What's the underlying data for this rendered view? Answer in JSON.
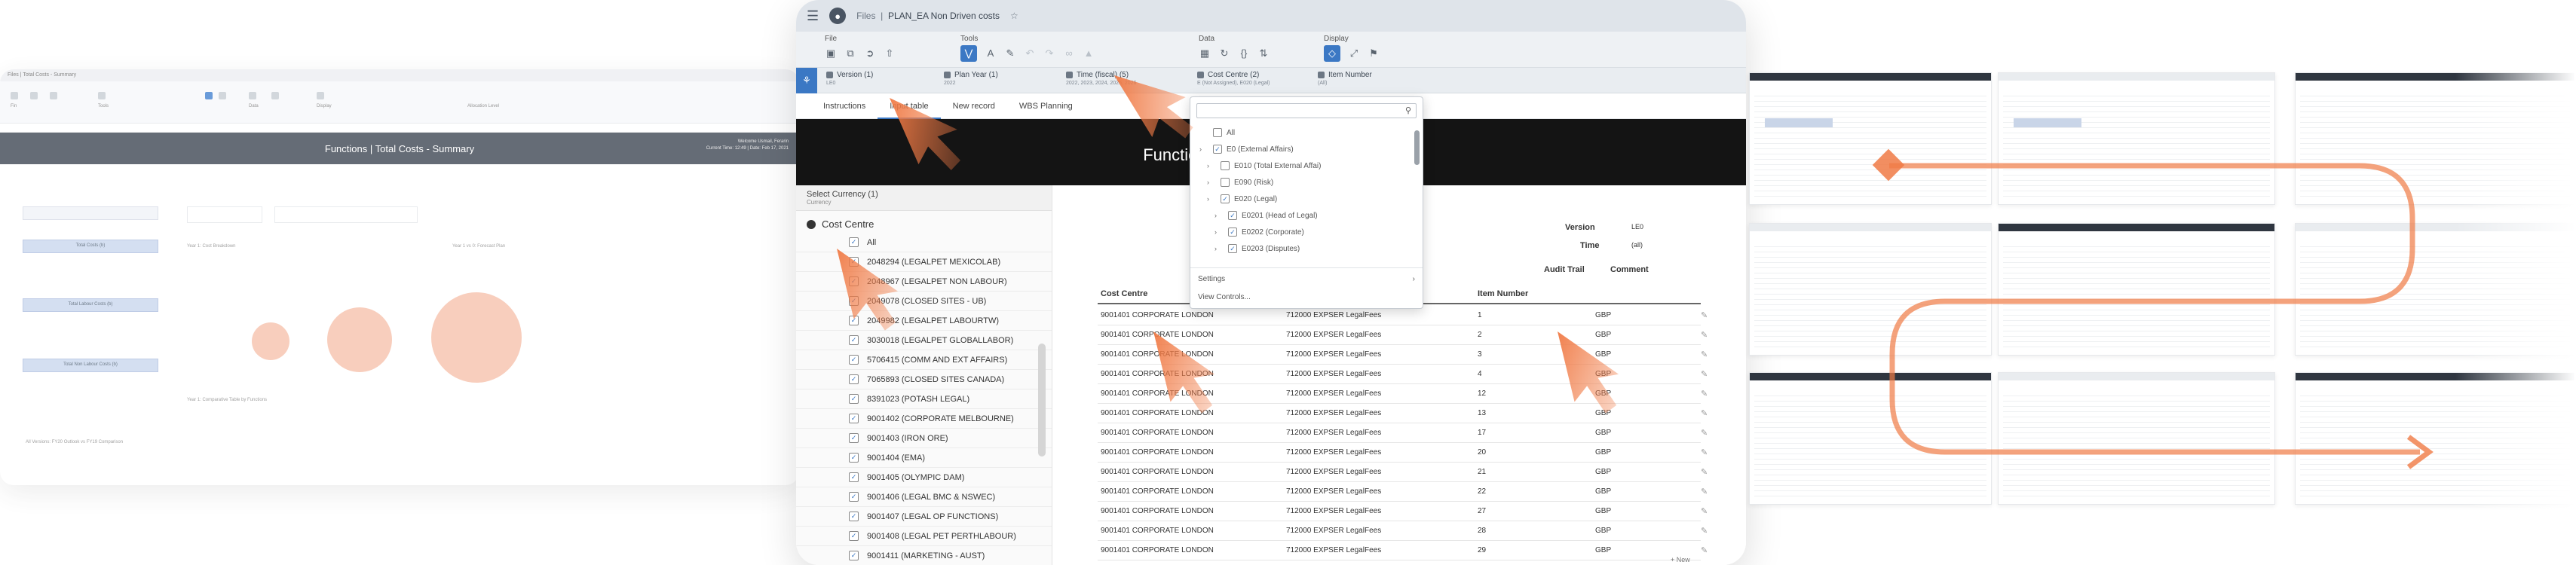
{
  "left_screen": {
    "window_title": "Files | Total Costs - Summary",
    "banner_title": "Functions | Total Costs - Summary",
    "banner_meta_1": "Welcome Usmail, Ferarin",
    "banner_meta_2": "Current Time: 12:49 | Date: Feb 17, 2021",
    "box_1": "Total Costs (b)",
    "box_2": "Total Labour Costs (b)",
    "box_3": "Total Non Labour Costs (b)",
    "note_1": "Year 1: Cost Breakdown",
    "note_2": "Year 1 vs 0: Forecast Plan",
    "note_3": "Year 1: Comparative Table by Functions",
    "note_4": "All Versions: FY20 Outlook vs FY19 Comparison"
  },
  "shell": {
    "breadcrumb_files": "Files",
    "breadcrumb_sep": "|",
    "breadcrumb_story": "PLAN_EA Non Driven costs"
  },
  "toolbar": {
    "file_label": "File",
    "tools_label": "Tools",
    "data_label": "Data",
    "display_label": "Display"
  },
  "filters": [
    {
      "label": "Version (1)",
      "sub": "LE0"
    },
    {
      "label": "Plan Year (1)",
      "sub": "2022"
    },
    {
      "label": "Time (fiscal) (5)",
      "sub": "2022, 2023, 2024, 2025, 2026"
    },
    {
      "label": "Cost Centre (2)",
      "sub": "E (Not Assigned), E020 (Legal)"
    },
    {
      "label": "Item Number",
      "sub": "(All)"
    }
  ],
  "tabs": [
    "Instructions",
    "Input table",
    "New record",
    "WBS Planning"
  ],
  "banner_title": "Functions | Non-driver based costs",
  "left_panel": {
    "currency_label": "Select Currency (1)",
    "currency_sub": "Currency",
    "section_title": "Cost Centre",
    "items": [
      "All",
      "2048294 (LEGALPET MEXICOLAB)",
      "2048967 (LEGALPET NON LABOUR)",
      "2049078 (CLOSED SITES - UB)",
      "2049982 (LEGALPET LABOURTW)",
      "3030018 (LEGALPET GLOBALLABOR)",
      "5706415 (COMM AND EXT AFFAIRS)",
      "7065893 (CLOSED SITES CANADA)",
      "8391023 (POTASH LEGAL)",
      "9001402 (CORPORATE MELBOURNE)",
      "9001403 (IRON ORE)",
      "9001404 (EMA)",
      "9001405 (OLYMPIC DAM)",
      "9001406 (LEGAL BMC & NSWEC)",
      "9001407 (LEGAL OP FUNCTIONS)",
      "9001408 (LEGAL PET PERTHLABOUR)",
      "9001411 (MARKETING - AUST)"
    ]
  },
  "settings": {
    "version_label": "Version",
    "version_value": "LE0",
    "time_label": "Time",
    "time_value": "(all)",
    "audit_trail": "Audit Trail",
    "comment": "Comment"
  },
  "grid": {
    "headers": [
      "Cost Centre",
      "",
      "Item Number",
      ""
    ],
    "rows": [
      [
        "9001401 CORPORATE LONDON",
        "712000 EXPSER LegalFees",
        "1",
        "GBP"
      ],
      [
        "9001401 CORPORATE LONDON",
        "712000 EXPSER LegalFees",
        "2",
        "GBP"
      ],
      [
        "9001401 CORPORATE LONDON",
        "712000 EXPSER LegalFees",
        "3",
        "GBP"
      ],
      [
        "9001401 CORPORATE LONDON",
        "712000 EXPSER LegalFees",
        "4",
        "GBP"
      ],
      [
        "9001401 CORPORATE LONDON",
        "712000 EXPSER LegalFees",
        "12",
        "GBP"
      ],
      [
        "9001401 CORPORATE LONDON",
        "712000 EXPSER LegalFees",
        "13",
        "GBP"
      ],
      [
        "9001401 CORPORATE LONDON",
        "712000 EXPSER LegalFees",
        "17",
        "GBP"
      ],
      [
        "9001401 CORPORATE LONDON",
        "712000 EXPSER LegalFees",
        "20",
        "GBP"
      ],
      [
        "9001401 CORPORATE LONDON",
        "712000 EXPSER LegalFees",
        "21",
        "GBP"
      ],
      [
        "9001401 CORPORATE LONDON",
        "712000 EXPSER LegalFees",
        "22",
        "GBP"
      ],
      [
        "9001401 CORPORATE LONDON",
        "712000 EXPSER LegalFees",
        "27",
        "GBP"
      ],
      [
        "9001401 CORPORATE LONDON",
        "712000 EXPSER LegalFees",
        "28",
        "GBP"
      ],
      [
        "9001401 CORPORATE LONDON",
        "712000 EXPSER LegalFees",
        "29",
        "GBP"
      ]
    ],
    "new_row_label": "+ New"
  },
  "popup": {
    "items": [
      {
        "label": "All",
        "level": 0,
        "checked": false,
        "arrow": false
      },
      {
        "label": "E0 (External Affairs)",
        "level": 0,
        "checked": true,
        "arrow": true
      },
      {
        "label": "E010 (Total External Affai)",
        "level": 1,
        "checked": false,
        "arrow": true
      },
      {
        "label": "E090 (Risk)",
        "level": 1,
        "checked": false,
        "arrow": true
      },
      {
        "label": "E020 (Legal)",
        "level": 1,
        "checked": true,
        "arrow": true
      },
      {
        "label": "E0201 (Head of Legal)",
        "level": 2,
        "checked": true,
        "arrow": true
      },
      {
        "label": "E0202 (Corporate)",
        "level": 2,
        "checked": true,
        "arrow": true
      },
      {
        "label": "E0203 (Disputes)",
        "level": 2,
        "checked": true,
        "arrow": true
      }
    ],
    "settings": "Settings",
    "view_controls": "View Controls..."
  },
  "colors": {
    "accent": "#3b78c4",
    "overlay_orange": "#f07a45",
    "banner_dark": "#141414"
  }
}
